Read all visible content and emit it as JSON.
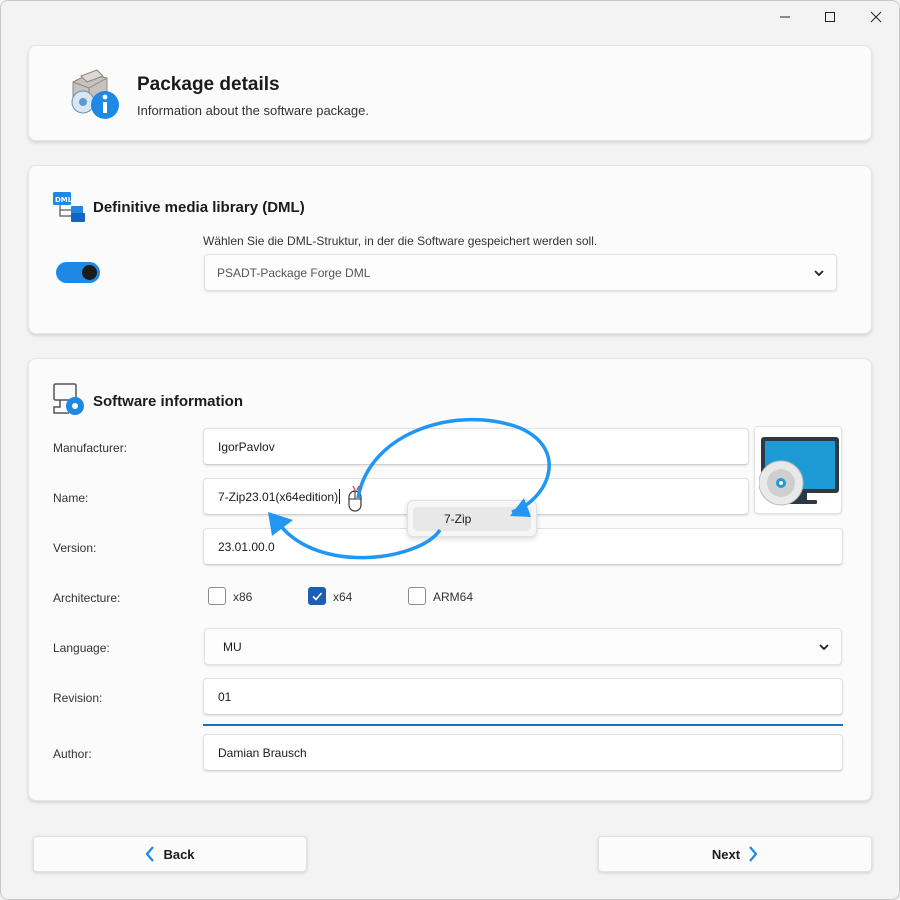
{
  "window": {
    "controls": [
      "minimize-icon",
      "maximize-icon",
      "close-icon"
    ]
  },
  "header": {
    "title": "Package details",
    "subtitle": "Information about the software package.",
    "icon": "package-info-icon"
  },
  "dml": {
    "title": "Definitive media library (DML)",
    "icon": "dml-folder-icon",
    "toggle_on": true,
    "description": "Wählen Sie die DML-Struktur, in der die Software gespeichert werden soll.",
    "selected": "PSADT-Package Forge DML"
  },
  "software": {
    "title": "Software information",
    "icon": "software-disc-icon",
    "manufacturer": {
      "label": "Manufacturer:",
      "value": "IgorPavlov"
    },
    "name": {
      "label": "Name:",
      "value": "7-Zip23.01(x64edition)"
    },
    "version": {
      "label": "Version:",
      "value": "23.01.00.0"
    },
    "architecture": {
      "label": "Architecture:",
      "options": [
        {
          "label": "x86",
          "checked": false
        },
        {
          "label": "x64",
          "checked": true
        },
        {
          "label": "ARM64",
          "checked": false
        }
      ]
    },
    "language": {
      "label": "Language:",
      "value": "MU"
    },
    "revision": {
      "label": "Revision:",
      "value": "01"
    },
    "author": {
      "label": "Author:",
      "value": "Damian Brausch"
    },
    "suggestion": "7-Zip",
    "app_icon": "monitor-disc-icon"
  },
  "footer": {
    "back_label": "Back",
    "next_label": "Next"
  },
  "colors": {
    "accent": "#1a5fb4",
    "arrow": "#2196f3",
    "toggle": "#1e88e5"
  }
}
